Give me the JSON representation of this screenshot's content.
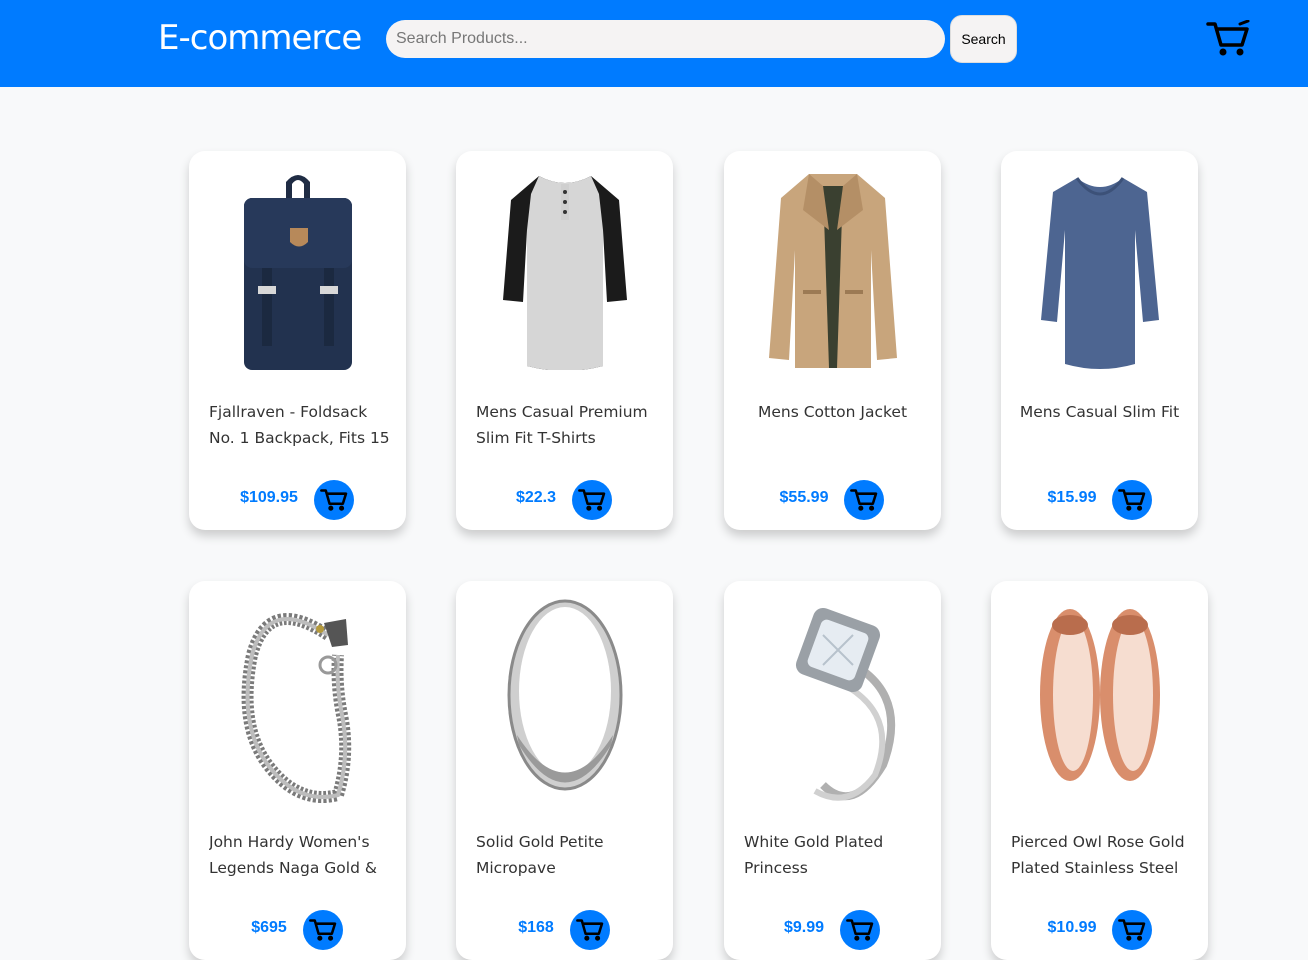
{
  "header": {
    "brand": "E-commerce",
    "search_placeholder": "Search Products...",
    "search_button": "Search",
    "cart_icon": "cart-icon"
  },
  "colors": {
    "primary": "#007bff",
    "background": "#f8f9fa"
  },
  "products": [
    {
      "title": "Fjallraven - Foldsack No. 1 Backpack, Fits 15",
      "price": "$109.95",
      "image": "backpack"
    },
    {
      "title": "Mens Casual Premium Slim Fit T-Shirts",
      "price": "$22.3",
      "image": "raglan-tshirt"
    },
    {
      "title": "Mens Cotton Jacket",
      "price": "$55.99",
      "image": "cotton-jacket"
    },
    {
      "title": "Mens Casual Slim Fit",
      "price": "$15.99",
      "image": "long-sleeve-shirt"
    },
    {
      "title": "John Hardy Women's Legends Naga Gold &",
      "price": "$695",
      "image": "dragon-bracelet"
    },
    {
      "title": "Solid Gold Petite Micropave",
      "price": "$168",
      "image": "silver-ring"
    },
    {
      "title": "White Gold Plated Princess",
      "price": "$9.99",
      "image": "diamond-ring"
    },
    {
      "title": "Pierced Owl Rose Gold Plated Stainless Steel",
      "price": "$10.99",
      "image": "rose-gold-plugs"
    }
  ]
}
